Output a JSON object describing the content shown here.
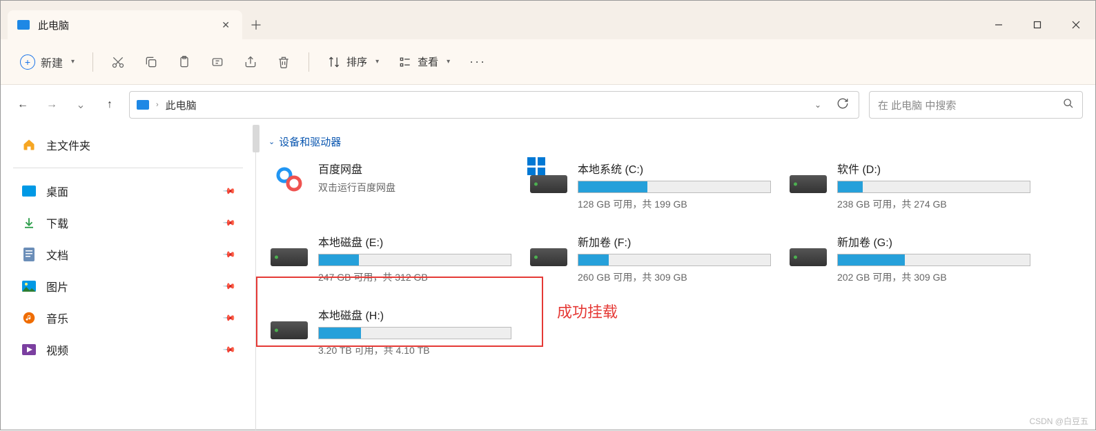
{
  "tab": {
    "title": "此电脑"
  },
  "toolbar": {
    "new_label": "新建",
    "sort_label": "排序",
    "view_label": "查看"
  },
  "breadcrumb": {
    "current": "此电脑"
  },
  "search": {
    "placeholder": "在 此电脑 中搜索"
  },
  "sidebar": {
    "home": "主文件夹",
    "items": [
      {
        "label": "桌面"
      },
      {
        "label": "下载"
      },
      {
        "label": "文档"
      },
      {
        "label": "图片"
      },
      {
        "label": "音乐"
      },
      {
        "label": "视频"
      }
    ]
  },
  "section": {
    "title": "设备和驱动器"
  },
  "drives": [
    {
      "title": "百度网盘",
      "sub": "双击运行百度网盘",
      "type": "app",
      "fill": 0
    },
    {
      "title": "本地系统 (C:)",
      "sub": "128 GB 可用，共 199 GB",
      "type": "win",
      "fill": 36
    },
    {
      "title": "软件 (D:)",
      "sub": "238 GB 可用，共 274 GB",
      "type": "hdd",
      "fill": 13
    },
    {
      "title": "本地磁盘 (E:)",
      "sub": "247 GB 可用，共 312 GB",
      "type": "hdd",
      "fill": 21
    },
    {
      "title": "新加卷 (F:)",
      "sub": "260 GB 可用，共 309 GB",
      "type": "hdd",
      "fill": 16
    },
    {
      "title": "新加卷 (G:)",
      "sub": "202 GB 可用，共 309 GB",
      "type": "hdd",
      "fill": 35
    },
    {
      "title": "本地磁盘 (H:)",
      "sub": "3.20 TB 可用，共 4.10 TB",
      "type": "hdd",
      "fill": 22
    }
  ],
  "annotation": {
    "text": "成功挂载"
  },
  "watermark": "CSDN @白豆五"
}
